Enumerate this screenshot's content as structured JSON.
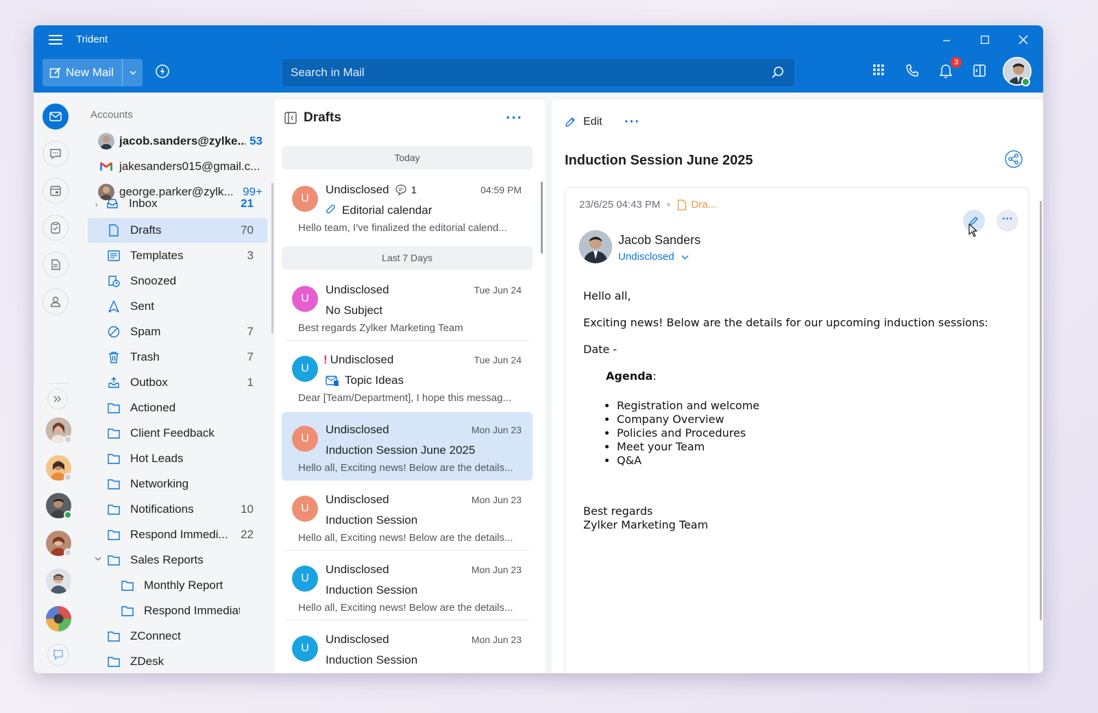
{
  "app": {
    "title": "Trident"
  },
  "toolbar": {
    "new_mail_label": "New Mail",
    "search_placeholder": "Search in Mail",
    "notification_count": "3"
  },
  "accounts": {
    "heading": "Accounts",
    "items": [
      {
        "name": "jacob.sanders@zylke...",
        "count": "53",
        "bold": true
      },
      {
        "name": "jakesanders015@gmail.c...",
        "count": ""
      },
      {
        "name": "george.parker@zylk...",
        "count": "99+"
      }
    ]
  },
  "folders": [
    {
      "name": "Inbox",
      "count": "21"
    },
    {
      "name": "Drafts",
      "count": "70"
    },
    {
      "name": "Templates",
      "count": "3"
    },
    {
      "name": "Snoozed",
      "count": ""
    },
    {
      "name": "Sent",
      "count": ""
    },
    {
      "name": "Spam",
      "count": "7"
    },
    {
      "name": "Trash",
      "count": "7"
    },
    {
      "name": "Outbox",
      "count": "1"
    },
    {
      "name": "Actioned",
      "count": ""
    },
    {
      "name": "Client Feedback",
      "count": ""
    },
    {
      "name": "Hot Leads",
      "count": ""
    },
    {
      "name": "Networking",
      "count": ""
    },
    {
      "name": "Notifications",
      "count": "10"
    },
    {
      "name": "Respond Immedi...",
      "count": "22"
    },
    {
      "name": "Sales Reports",
      "count": ""
    },
    {
      "name": "Monthly Report",
      "count": ""
    },
    {
      "name": "Respond Immediat...",
      "count": ""
    },
    {
      "name": "ZConnect",
      "count": ""
    },
    {
      "name": "ZDesk",
      "count": ""
    }
  ],
  "list": {
    "title": "Drafts",
    "groups": [
      "Today",
      "Last 7 Days"
    ],
    "mails": [
      {
        "from": "Undisclosed",
        "comment_count": "1",
        "time": "04:59 PM",
        "subject": "Editorial calendar",
        "preview": "Hello team, I've finalized the editorial calend...",
        "avatar": "U",
        "color": "#ee8e72"
      },
      {
        "from": "Undisclosed",
        "time": "Tue Jun 24",
        "subject": "No Subject",
        "preview": "Best regards Zylker Marketing Team",
        "avatar": "U",
        "color": "#e65fd0"
      },
      {
        "from": "Undisclosed",
        "time": "Tue Jun 24",
        "subject": "Topic Ideas",
        "preview": "Dear [Team/Department], I hope this messag...",
        "avatar": "U",
        "color": "#1aa3e0"
      },
      {
        "from": "Undisclosed",
        "time": "Mon Jun 23",
        "subject": "Induction Session June 2025",
        "preview": "Hello all, Exciting news! Below are the details...",
        "avatar": "U",
        "color": "#ee8e72"
      },
      {
        "from": "Undisclosed",
        "time": "Mon Jun 23",
        "subject": "Induction Session",
        "preview": "Hello all, Exciting news! Below are the details...",
        "avatar": "U",
        "color": "#ee8e72"
      },
      {
        "from": "Undisclosed",
        "time": "Mon Jun 23",
        "subject": "Induction Session",
        "preview": "Hello all, Exciting news! Below are the details...",
        "avatar": "U",
        "color": "#1aa3e0"
      },
      {
        "from": "Undisclosed",
        "time": "Mon Jun 23",
        "subject": "Induction Session",
        "preview": "",
        "avatar": "U",
        "color": "#1aa3e0"
      }
    ]
  },
  "reading": {
    "edit_label": "Edit",
    "subject": "Induction Session June 2025",
    "datetime": "23/6/25 04:43 PM",
    "draft_label": "Dra...",
    "sender": "Jacob Sanders",
    "recipient": "Undisclosed",
    "body": {
      "greeting": "Hello all,",
      "intro": "Exciting news! Below are the details for our upcoming induction sessions:",
      "date_line": "Date -",
      "agenda_label": "Agenda",
      "agenda_colon": ":",
      "agenda_items": [
        "Registration and welcome",
        "Company Overview",
        "Policies and Procedures",
        "Meet your Team",
        "Q&A"
      ],
      "sign_1": "Best regards",
      "sign_2": "Zylker Marketing Team"
    }
  },
  "colors": {
    "brand": "#0a74d6",
    "selected": "#d6e6f8",
    "draft": "#e8963c"
  }
}
